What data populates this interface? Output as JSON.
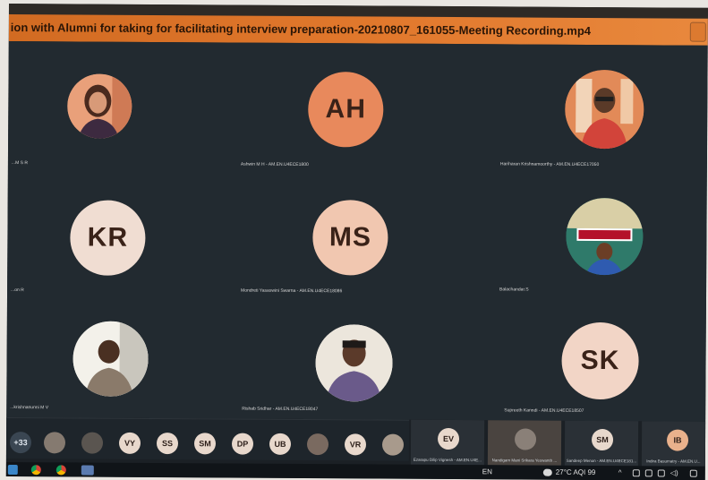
{
  "window": {
    "title": "ion with Alumni for taking for facilitating interview preparation-20210807_161055-Meeting Recording.mp4"
  },
  "participants": [
    {
      "initials": "",
      "name": "...M S R",
      "kind": "photo",
      "avatar_color": "#e8a07c"
    },
    {
      "initials": "AH",
      "name": "Ashwin M H - AM.EN.U4ECE1800",
      "kind": "initials",
      "avatar_color": "#e8895c"
    },
    {
      "initials": "",
      "name": "Hariharan Krishnamoorthy - AM.EN.U4ECE17050",
      "kind": "photo",
      "avatar_color": "#e07a48"
    },
    {
      "initials": "KR",
      "name": "...on R",
      "kind": "initials",
      "avatar_color": "#f0ddd2"
    },
    {
      "initials": "MS",
      "name": "Mondreti Yasaswini Swarna - AM.EN.U4ECE18086",
      "kind": "initials",
      "avatar_color": "#f1c7b0"
    },
    {
      "initials": "",
      "name": "Balachandar.S",
      "kind": "photo",
      "avatar_color": "#2f7a6a"
    },
    {
      "initials": "",
      "name": "...krishnanunni M V",
      "kind": "photo",
      "avatar_color": "#efefe8"
    },
    {
      "initials": "",
      "name": "Rishab Sridhar - AM.EN.U4ECE18047",
      "kind": "photo",
      "avatar_color": "#e9e3da"
    },
    {
      "initials": "SK",
      "name": "Supreeth Kanndi - AM.EN.U4ECE18507",
      "kind": "initials",
      "avatar_color": "#f2d5c6"
    }
  ],
  "strip": {
    "more_count": "+33",
    "left_chips": [
      "",
      "",
      "VY",
      "SS",
      "SM",
      "DP",
      "UB",
      "",
      "VR",
      ""
    ],
    "right_cards": [
      {
        "initials": "EV",
        "name": "Ezarapu Dilip Vignesh - AM.EN.U4E..."
      },
      {
        "initials": "",
        "name": "Nandigam Mani Srikara Yeswanth ..."
      },
      {
        "initials": "SM",
        "name": "Sandeep Menon - AM.EN.U4ECE181..."
      },
      {
        "initials": "IB",
        "name": "Indira Basumatry - AM.EN.U..."
      }
    ]
  },
  "taskbar": {
    "language": "EN",
    "weather": "27°C AQI 99"
  },
  "colors": {
    "titlebar": "#e2792d",
    "stage_bg": "#222a30",
    "strip_bg": "#1b2025"
  },
  "icons": [
    "windows-logo-icon",
    "chrome-icon",
    "chrome-profile-icon",
    "app-icon",
    "cloud-icon",
    "chevron-up-icon",
    "network-icon",
    "volume-icon",
    "pen-icon"
  ]
}
